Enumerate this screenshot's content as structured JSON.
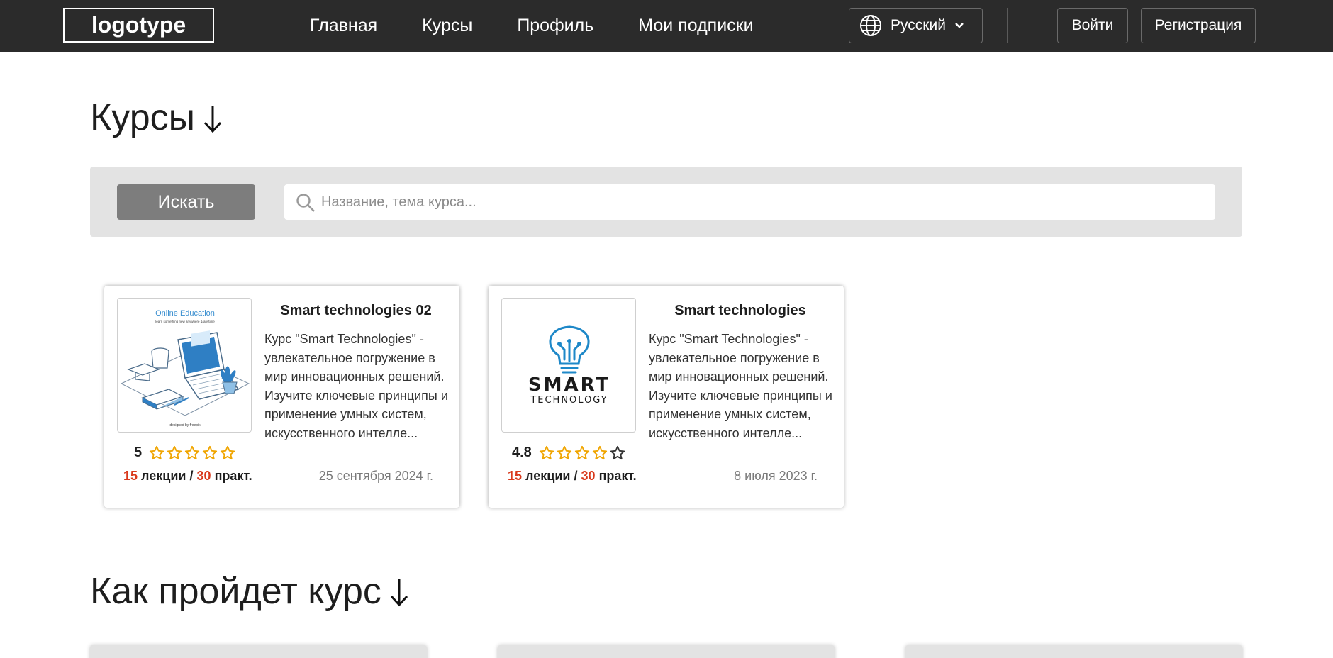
{
  "header": {
    "logo": "logotype",
    "nav": [
      "Главная",
      "Курсы",
      "Профиль",
      "Мои подписки"
    ],
    "language": "Русский",
    "login": "Войти",
    "register": "Регистрация"
  },
  "courses_section": {
    "title": "Курсы"
  },
  "search": {
    "button": "Искать",
    "placeholder": "Название, тема курса..."
  },
  "courses": [
    {
      "title": "Smart technologies 02",
      "description": "Курс \"Smart Technologies\" - увлекательное погружение в мир инновационных решений. Изучите ключевые принципы и применение умных систем, искусственного интелле...",
      "rating": "5",
      "rating_stars": 5,
      "lectures": "15",
      "lectures_label": "лекции",
      "practice": "30",
      "practice_label": "практ.",
      "separator": "/",
      "date": "25 сентября 2024 г.",
      "image": {
        "type": "online-education-illustration",
        "caption": "Online Education",
        "subcaption": "learn something new anywhere & anytime",
        "credit": "designed by freepik"
      }
    },
    {
      "title": "Smart technologies",
      "description": "Курс \"Smart Technologies\" - увлекательное погружение в мир инновационных решений. Изучите ключевые принципы и применение умных систем, искусственного интелле...",
      "rating": "4.8",
      "rating_stars": 4,
      "lectures": "15",
      "lectures_label": "лекции",
      "practice": "30",
      "practice_label": "практ.",
      "separator": "/",
      "date": "8 июля 2023 г.",
      "image": {
        "type": "smart-technology-logo",
        "line1": "SMART",
        "line2": "TECHNOLOGY"
      }
    }
  ],
  "how_section": {
    "title": "Как пройдет курс"
  },
  "colors": {
    "header_bg": "#2b2b2b",
    "accent_number": "#d9391c",
    "star": "#f0a500",
    "search_button": "#7d7d7d",
    "panel_bg": "#e3e3e3",
    "bulb_blue": "#1e88c8"
  }
}
